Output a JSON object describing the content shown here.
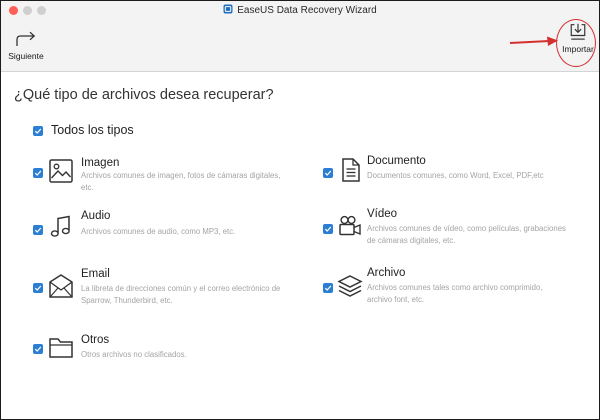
{
  "window": {
    "title": "EaseUS Data Recovery Wizard"
  },
  "toolbar": {
    "next_label": "Siguiente",
    "import_label": "Importar",
    "next_icon": "redo-arrow-icon",
    "import_icon": "import-tray-icon"
  },
  "main": {
    "question": "¿Qué tipo de archivos desea recuperar?",
    "all_types": {
      "label": "Todos los tipos",
      "checked": true
    },
    "file_types": [
      {
        "id": "image",
        "title": "Imagen",
        "description": "Archivos comunes de imagen, fotos de cámaras digitales, etc.",
        "icon": "image-icon",
        "checked": true
      },
      {
        "id": "document",
        "title": "Documento",
        "description": "Documentos comunes, como Word, Excel, PDF,etc",
        "icon": "document-icon",
        "checked": true
      },
      {
        "id": "audio",
        "title": "Audio",
        "description": "Archivos comunes de audio, como MP3, etc.",
        "icon": "music-note-icon",
        "checked": true
      },
      {
        "id": "video",
        "title": "Vídeo",
        "description": "Archivos comunes  de vídeo, como películas, grabaciones de cámaras digitales, etc.",
        "icon": "video-camera-icon",
        "checked": true
      },
      {
        "id": "email",
        "title": "Email",
        "description": "La libreta de direcciones común y el correo electrónico de Sparrow, Thunderbird, etc.",
        "icon": "envelope-icon",
        "checked": true
      },
      {
        "id": "archive",
        "title": "Archivo",
        "description": "Archivos comunes  tales como archivo comprimido, archivo font, etc.",
        "icon": "layers-icon",
        "checked": true
      },
      {
        "id": "others",
        "title": "Otros",
        "description": "Otros archivos no clasificados.",
        "icon": "folder-icon",
        "checked": true
      }
    ]
  },
  "colors": {
    "checkbox": "#2a7fd4",
    "annotation": "#d42f2f",
    "description_text": "#a4a4a4",
    "toolbar_bg": "#f3f3f3"
  }
}
